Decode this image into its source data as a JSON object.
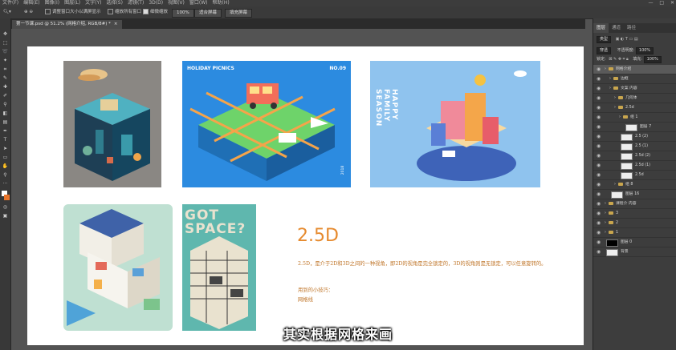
{
  "menu": {
    "items": [
      "文件(F)",
      "编辑(E)",
      "图像(I)",
      "图层(L)",
      "文字(Y)",
      "选择(S)",
      "滤镜(T)",
      "3D(D)",
      "视图(V)",
      "窗口(W)",
      "帮助(H)"
    ],
    "window_controls": [
      "—",
      "□",
      "✕"
    ]
  },
  "options": {
    "opt1": "调整窗口大小以满屏显示",
    "opt2": "缩放所有窗口",
    "opt3": "细微缩放",
    "zoom_value": "100%",
    "fit_button": "适合屏幕",
    "fill_button": "填充屏幕"
  },
  "document_tab": {
    "title": "第一节课.psd @ 51.2% (网格介绍, RGB/8#) *",
    "close": "×"
  },
  "panel": {
    "tabs": [
      "图层",
      "通道",
      "路径"
    ],
    "filter_kind": "类型",
    "blend_mode": "穿透",
    "opacity_label": "不透明度:",
    "opacity_value": "100%",
    "lock_label": "锁定:",
    "fill_label": "填充:",
    "fill_value": "100%",
    "layers": [
      {
        "name": "网格介绍",
        "type": "group",
        "indent": 0,
        "selected": true
      },
      {
        "name": "边框",
        "type": "group",
        "indent": 1,
        "selected": false
      },
      {
        "name": "文案 内容",
        "type": "group",
        "indent": 1,
        "selected": false
      },
      {
        "name": "几何体",
        "type": "group",
        "indent": 2,
        "selected": false
      },
      {
        "name": "2.5d",
        "type": "group",
        "indent": 2,
        "selected": false
      },
      {
        "name": "组 1",
        "type": "group",
        "indent": 3,
        "selected": false
      },
      {
        "name": "图层 7",
        "type": "layer",
        "indent": 4,
        "selected": false
      },
      {
        "name": "2.5 (2)",
        "type": "layer",
        "indent": 3,
        "selected": false
      },
      {
        "name": "2.5 (1)",
        "type": "layer",
        "indent": 3,
        "selected": false
      },
      {
        "name": "2.5d (2)",
        "type": "layer",
        "indent": 3,
        "selected": false
      },
      {
        "name": "2.5d (1)",
        "type": "layer",
        "indent": 3,
        "selected": false
      },
      {
        "name": "2.5d",
        "type": "layer",
        "indent": 3,
        "selected": false
      },
      {
        "name": "组 8",
        "type": "group",
        "indent": 2,
        "selected": false
      },
      {
        "name": "图层 16",
        "type": "layer",
        "indent": 1,
        "selected": false
      },
      {
        "name": "课程介 内容",
        "type": "group",
        "indent": 0,
        "selected": false
      },
      {
        "name": "3",
        "type": "group",
        "indent": 0,
        "selected": false
      },
      {
        "name": "2",
        "type": "group",
        "indent": 0,
        "selected": false
      },
      {
        "name": "1",
        "type": "group",
        "indent": 0,
        "selected": false
      },
      {
        "name": "图层 0",
        "type": "layer",
        "indent": 0,
        "selected": false
      },
      {
        "name": "背景",
        "type": "layer",
        "indent": 0,
        "selected": false
      }
    ]
  },
  "canvas": {
    "poster_holiday_title": "HOLIDAY PICNICS",
    "poster_holiday_no": "NO.09",
    "poster_holiday_year": "2018",
    "poster_family_title": "HAPPY FAMILY SEASON",
    "poster_got_space": "GOT SPACE?",
    "heading": "2.5D",
    "description": "2.5D，是介于2D和3D之间的一种视角，即2D的视角是完全锁定的，3D的视角则是无锁定，可以任意旋转的。",
    "tip_label": "用到的小技巧：",
    "tip_value": "网格线"
  },
  "subtitle": "其实根据网格来画"
}
